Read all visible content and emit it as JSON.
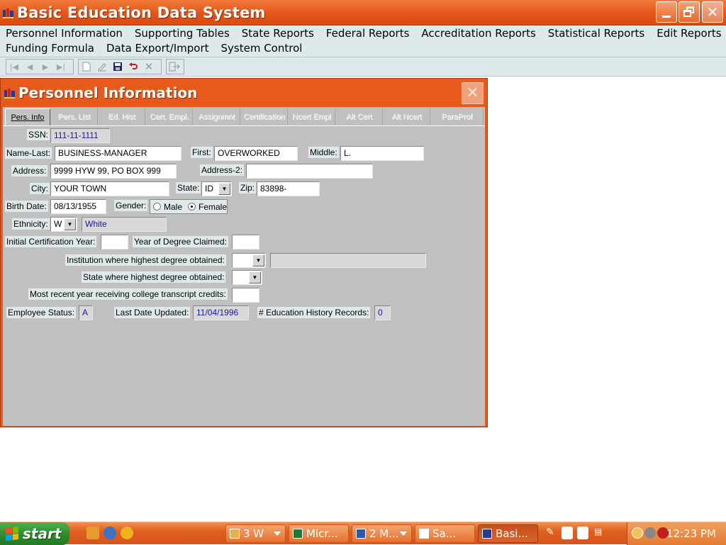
{
  "app": {
    "title": "Basic Education Data System",
    "window_buttons": {
      "minimize": "_",
      "maximize": "❐",
      "close": "✕"
    }
  },
  "menu": {
    "row1": [
      "Personnel Information",
      "Supporting Tables",
      "State Reports",
      "Federal Reports",
      "Accreditation Reports",
      "Statistical Reports",
      "Edit Reports"
    ],
    "row2": [
      "Funding Formula",
      "Data Export/Import",
      "System Control"
    ]
  },
  "toolbar": {
    "icons": [
      "first-record-icon",
      "previous-record-icon",
      "next-record-icon",
      "last-record-icon",
      "new-record-icon",
      "edit-record-icon",
      "save-icon",
      "undo-icon",
      "delete-icon",
      "exit-icon"
    ]
  },
  "child": {
    "title": "Personnel Information",
    "close": "✕",
    "tabs": [
      "Pers. Info",
      "Pers. List",
      "Ed. Hist",
      "Cert. Empl.",
      "Assignmnt",
      "Certification",
      "Ncert Empl",
      "Alt Cert",
      "Alt Ncert",
      "ParaProf"
    ],
    "active_tab": "Pers. Info"
  },
  "form": {
    "ssn": {
      "label": "SSN:",
      "value": "111-11-1111"
    },
    "name_last": {
      "label": "Name-Last:",
      "value": "BUSINESS-MANAGER"
    },
    "first": {
      "label": "First:",
      "value": "OVERWORKED"
    },
    "middle": {
      "label": "Middle:",
      "value": "L."
    },
    "address": {
      "label": "Address:",
      "value": "9999 HYW 99, PO BOX 999"
    },
    "address2": {
      "label": "Address-2:",
      "value": ""
    },
    "city": {
      "label": "City:",
      "value": "YOUR TOWN"
    },
    "state": {
      "label": "State:",
      "value": "ID"
    },
    "zip": {
      "label": "Zip:",
      "value": "83898-"
    },
    "birth_date": {
      "label": "Birth Date:",
      "value": "08/13/1955"
    },
    "gender": {
      "label": "Gender:",
      "options": [
        "Male",
        "Female"
      ],
      "selected": "Female"
    },
    "ethnicity": {
      "label": "Ethnicity:",
      "code": "W",
      "description": "White"
    },
    "initial_cert_year": {
      "label": "Initial Certification Year:",
      "value": ""
    },
    "year_degree_claimed": {
      "label": "Year of Degree Claimed:",
      "value": ""
    },
    "institution": {
      "label": "Institution where highest degree obtained:",
      "value": "",
      "description": ""
    },
    "state_degree": {
      "label": "State where highest degree obtained:",
      "value": ""
    },
    "recent_transcript": {
      "label": "Most recent year receiving college transcript credits:",
      "value": ""
    },
    "employee_status": {
      "label": "Employee Status:",
      "value": "A"
    },
    "last_updated": {
      "label": "Last Date Updated:",
      "value": "11/04/1996"
    },
    "edu_history": {
      "label": "# Education History Records:",
      "value": "0"
    }
  },
  "taskbar": {
    "start": "start",
    "tasks": [
      {
        "label": "3 W",
        "icon": "folder-icon",
        "group": true
      },
      {
        "label": "Micr...",
        "icon": "excel-icon"
      },
      {
        "label": "2 M...",
        "icon": "outlook-icon",
        "group": true
      },
      {
        "label": "Sa...",
        "icon": "word-icon"
      },
      {
        "label": "Basi...",
        "icon": "app-icon",
        "active": true
      }
    ],
    "clock": "12:23 PM"
  },
  "colors": {
    "title_orange": "#e3551a",
    "menu_bg": "#dde9ea",
    "form_bg": "#c0c0c0",
    "readonly_text": "#1a1a9a",
    "start_green": "#2b8a2b"
  }
}
